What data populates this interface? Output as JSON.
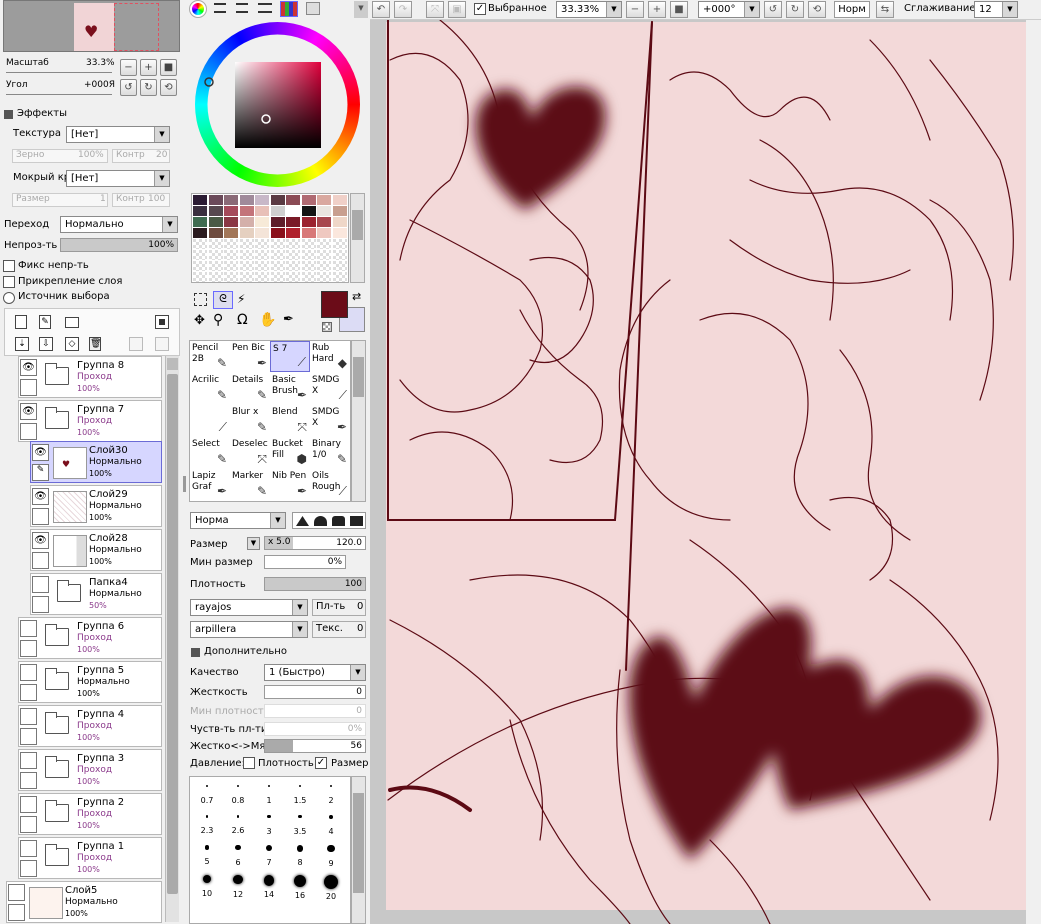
{
  "colors": {
    "accent_layer_bg": "#d6d6ff",
    "canvas_bg": "#f3d9d9",
    "ink": "#5c0a14",
    "main_color": "#6b0c18",
    "sub_color": "#dcdcf5"
  },
  "toolbar": {
    "selection_label": "Выбранное",
    "zoom": "33.33%",
    "rotation": "+000°",
    "mode": "Норм",
    "smoothing_label": "Сглаживание",
    "smoothing": "12"
  },
  "navigator": {
    "zoom_label": "Масштаб",
    "zoom_value": "33.3%",
    "angle_label": "Угол",
    "angle_value": "+000Я"
  },
  "effects": {
    "title": "Эффекты",
    "texture_label": "Текстура",
    "texture_value": "[Нет]",
    "grain_label": "Зерно",
    "grain_value": "100%",
    "contrast_label": "Контр",
    "contrast_value": "20",
    "wet_label": "Мокрый кр",
    "wet_value": "[Нет]",
    "size_label": "Размер",
    "size_value": "1",
    "contrast2_label": "Контр",
    "contrast2_value": "100"
  },
  "layer_props": {
    "blend_label": "Переход",
    "blend_value": "Нормально",
    "opacity_label": "Непроз-ть",
    "opacity_value": "100%",
    "fix_opacity": "Фикс непр-ть",
    "clipping": "Прикрепление слоя",
    "selection_source": "Источник выбора"
  },
  "layers": [
    {
      "name": "Группа 8",
      "mode": "Проход",
      "opacity": "100%",
      "type": "folder",
      "visible": true
    },
    {
      "name": "Группа 7",
      "mode": "Проход",
      "opacity": "100%",
      "type": "folder",
      "visible": true
    },
    {
      "name": "Слой30",
      "mode": "Нормально",
      "opacity": "100%",
      "type": "layer",
      "visible": true,
      "selected": true
    },
    {
      "name": "Слой29",
      "mode": "Нормально",
      "opacity": "100%",
      "type": "layer",
      "visible": true
    },
    {
      "name": "Слой28",
      "mode": "Нормально",
      "opacity": "100%",
      "type": "layer",
      "visible": true
    },
    {
      "name": "Папка4",
      "mode": "Нормально",
      "opacity": "50%",
      "type": "folder",
      "visible": false
    },
    {
      "name": "Группа 6",
      "mode": "Проход",
      "opacity": "100%",
      "type": "folder",
      "visible": false
    },
    {
      "name": "Группа 5",
      "mode": "Нормально",
      "opacity": "100%",
      "type": "folder",
      "visible": false
    },
    {
      "name": "Группа 4",
      "mode": "Проход",
      "opacity": "100%",
      "type": "folder",
      "visible": false
    },
    {
      "name": "Группа 3",
      "mode": "Проход",
      "opacity": "100%",
      "type": "folder",
      "visible": false
    },
    {
      "name": "Группа 2",
      "mode": "Проход",
      "opacity": "100%",
      "type": "folder",
      "visible": false
    },
    {
      "name": "Группа 1",
      "mode": "Проход",
      "opacity": "100%",
      "type": "folder",
      "visible": false
    },
    {
      "name": "Слой5",
      "mode": "Нормально",
      "opacity": "100%",
      "type": "layer",
      "visible": false
    }
  ],
  "tools": [
    [
      "Pencil 2B",
      "Pen Bic",
      "S 7",
      "Rub Hard"
    ],
    [
      "Acrilic",
      "Details",
      "Basic Brush",
      "SMDG X"
    ],
    [
      "",
      "Blur x",
      "Blend",
      "SMDG X"
    ],
    [
      "Select",
      "Deselec",
      "Bucket Fill",
      "Binary 1/0"
    ],
    [
      "Lapiz Graf",
      "Marker",
      "Nib Pen",
      "Oils Rough"
    ]
  ],
  "brush": {
    "blend_mode": "Норма",
    "size_label": "Размер",
    "size_mult": "x 5.0",
    "size_value": "120.0",
    "min_size_label": "Мин размер",
    "min_size_value": "0%",
    "density_label": "Плотность",
    "density_value": "100",
    "shape1": "rayajos",
    "shape1_label": "Пл-ть",
    "shape1_value": "0",
    "shape2": "arpillera",
    "shape2_label": "Текс.",
    "shape2_value": "0",
    "advanced": "Дополнительно",
    "quality_label": "Качество",
    "quality_value": "1 (Быстро)",
    "hardness_label": "Жесткость",
    "hardness_value": "0",
    "min_density_label": "Мин плотность",
    "min_density_value": "0",
    "sensitivity_label": "Чуств-ть пл-ти",
    "sensitivity_value": "0%",
    "soft_label": "Жестко<->Мягко",
    "soft_value": "56",
    "pressure_label": "Давление:",
    "pressure_density": "Плотность",
    "pressure_size": "Размер"
  },
  "brush_sizes": [
    "0.7",
    "0.8",
    "1",
    "1.5",
    "2",
    "2.3",
    "2.6",
    "3",
    "3.5",
    "4",
    "5",
    "6",
    "7",
    "8",
    "9",
    "10",
    "12",
    "14",
    "16",
    "20"
  ],
  "swatches": [
    "#2b1b33",
    "#6b4a5a",
    "#8a6a77",
    "#a08a9a",
    "#c8b8c8",
    "#5a3a42",
    "#8b4b55",
    "#b06a72",
    "#d9a89f",
    "#f0d0c8",
    "#3a2f3f",
    "#57484f",
    "#a54a5a",
    "#c3747a",
    "#e8c0b8",
    "#cfcfcf",
    "#ffffff",
    "#141414",
    "#e9e5e0",
    "#c89f8f",
    "#3f6b50",
    "#4a5a45",
    "#8a3844",
    "#d4b0aa",
    "#f7ead8",
    "#5f1d2a",
    "#7a1a28",
    "#9c2330",
    "#a8474e",
    "#efd7c8",
    "#2a1a1e",
    "#6e4b3e",
    "#a27658",
    "#e5d0c0",
    "#f4e4d8",
    "#8a0f1a",
    "#b0202c",
    "#d87878",
    "#efc8c0",
    "#fbe7dd"
  ]
}
